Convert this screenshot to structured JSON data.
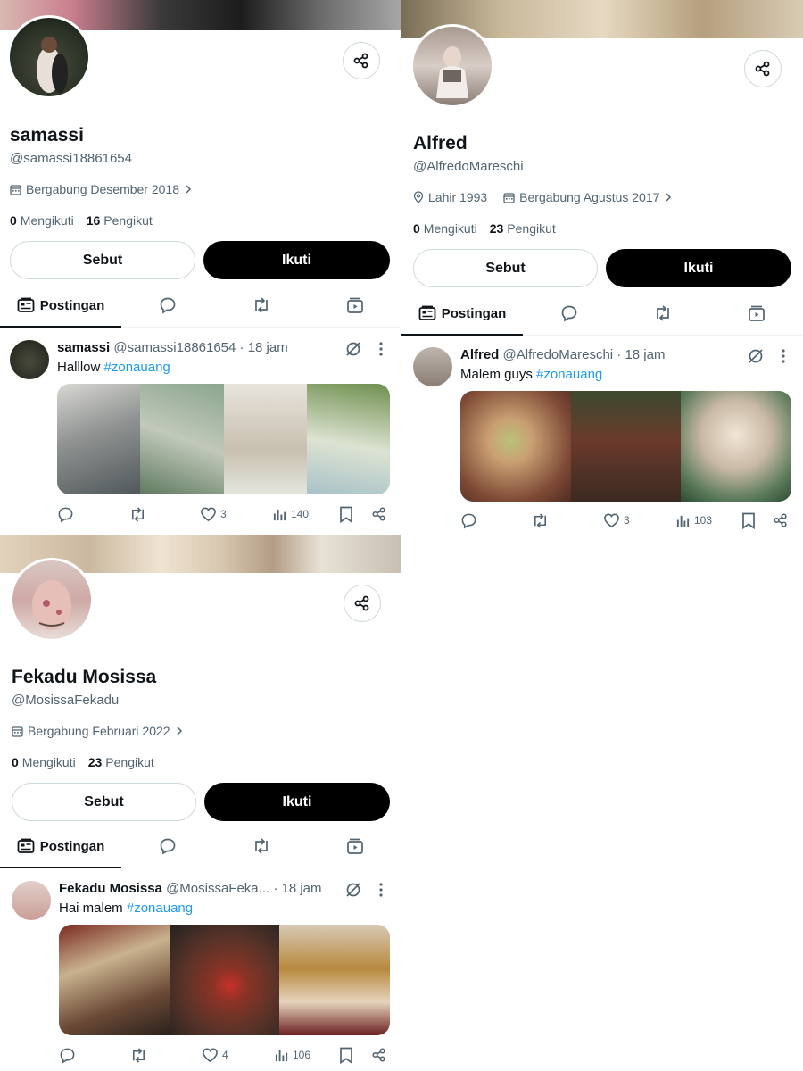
{
  "profiles": [
    {
      "name": "samassi",
      "handle": "@samassi18861654",
      "birth": "",
      "joined": "Bergabung Desember 2018",
      "following_count": "0",
      "following_label": "Mengikuti",
      "followers_count": "16",
      "followers_label": "Pengikut",
      "mention_label": "Sebut",
      "follow_label": "Ikuti",
      "tab_posts_label": "Postingan",
      "post": {
        "author": "samassi",
        "handle": "@samassi18861654",
        "time": "· 18 jam",
        "text": "Halllow",
        "hashtag": "#zonauang",
        "likes": "3",
        "views": "140"
      }
    },
    {
      "name": "Alfred",
      "handle": "@AlfredoMareschi",
      "birth": "Lahir 1993",
      "joined": "Bergabung Agustus 2017",
      "following_count": "0",
      "following_label": "Mengikuti",
      "followers_count": "23",
      "followers_label": "Pengikut",
      "mention_label": "Sebut",
      "follow_label": "Ikuti",
      "tab_posts_label": "Postingan",
      "post": {
        "author": "Alfred",
        "handle": "@AlfredoMareschi",
        "time": "· 18 jam",
        "text": "Malem guys",
        "hashtag": "#zonauang",
        "likes": "3",
        "views": "103"
      }
    },
    {
      "name": "Fekadu Mosissa",
      "handle": "@MosissaFekadu",
      "birth": "",
      "joined": "Bergabung Februari 2022",
      "following_count": "0",
      "following_label": "Mengikuti",
      "followers_count": "23",
      "followers_label": "Pengikut",
      "mention_label": "Sebut",
      "follow_label": "Ikuti",
      "tab_posts_label": "Postingan",
      "post": {
        "author": "Fekadu Mosissa",
        "handle": "@MosissaFeka...",
        "time": "· 18 jam",
        "text": "Hai malem",
        "hashtag": "#zonauang",
        "likes": "4",
        "views": "106"
      }
    }
  ],
  "icons": [
    "share-icon",
    "calendar-icon",
    "location-icon",
    "chevron-right-icon",
    "posts-tab-icon",
    "replies-icon",
    "repost-icon",
    "media-icon",
    "grok-icon",
    "more-icon",
    "reply-icon",
    "like-icon",
    "views-icon",
    "bookmark-icon"
  ],
  "colors": {
    "accent": "#1d9bf0",
    "text": "#0f1419",
    "muted": "#536471",
    "border": "#cfd9de"
  }
}
